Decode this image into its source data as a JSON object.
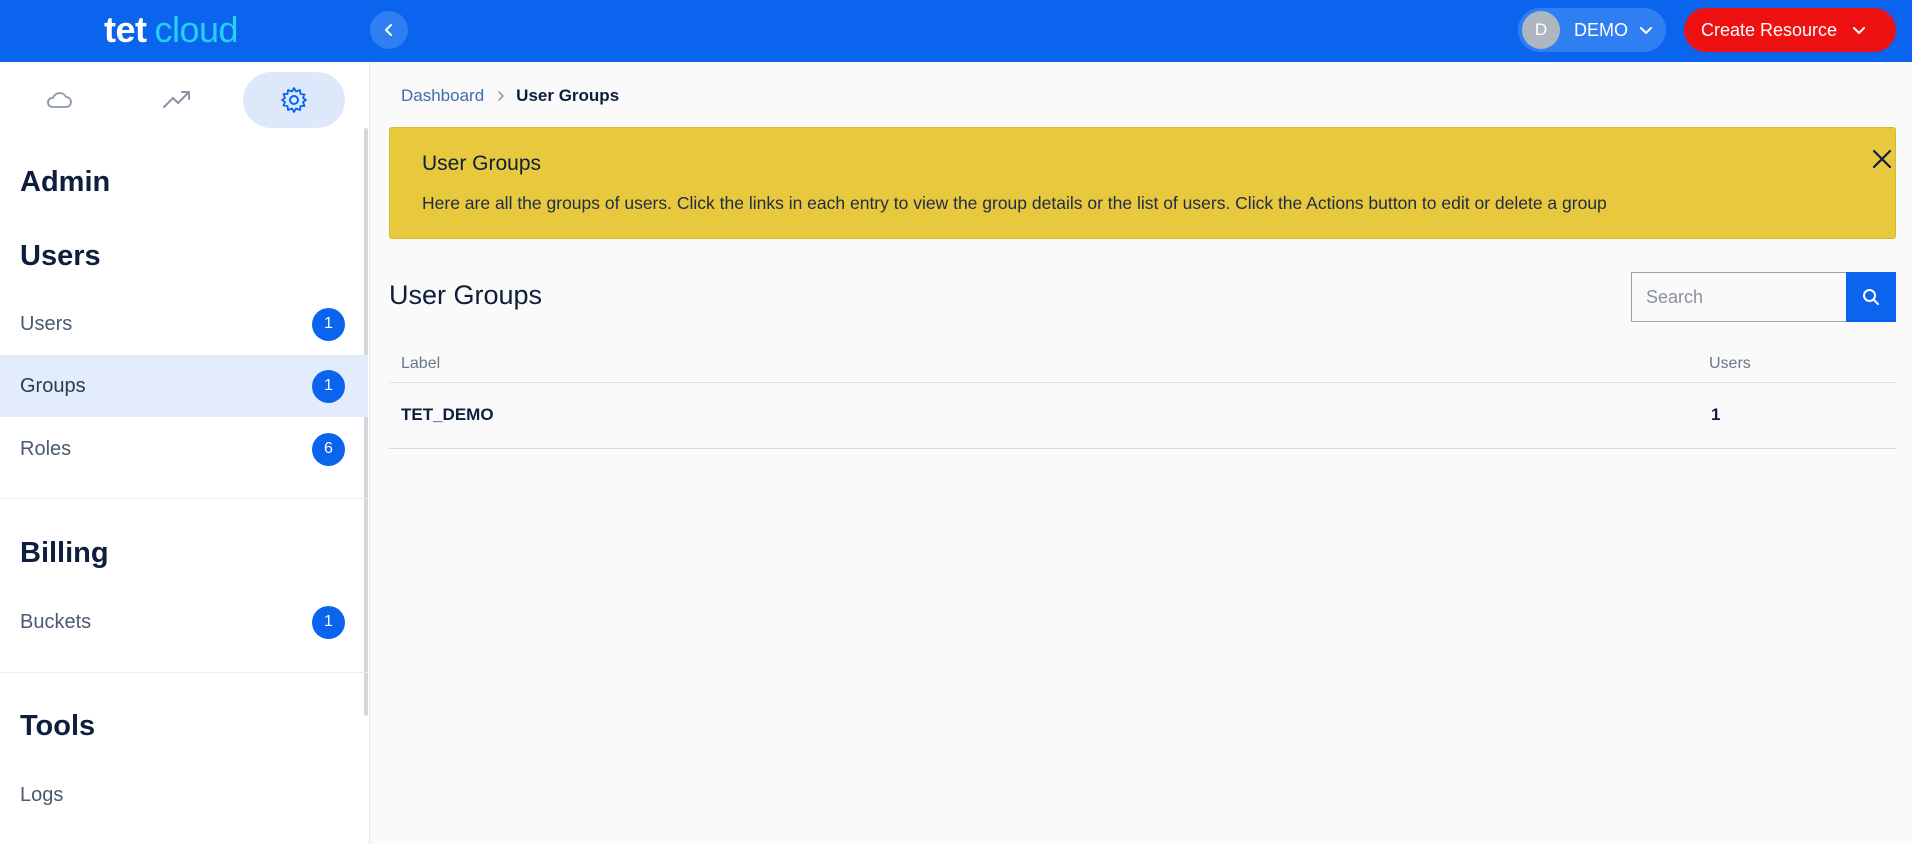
{
  "brand": {
    "logo_tet": "tet",
    "logo_cloud": "cloud"
  },
  "header": {
    "account_initial": "D",
    "account_name": "DEMO",
    "create_label": "Create Resource"
  },
  "sidebar": {
    "tabs": [
      {
        "icon": "cloud-icon",
        "active": false
      },
      {
        "icon": "trending-up-icon",
        "active": false
      },
      {
        "icon": "gear-icon",
        "active": true
      }
    ],
    "admin_heading": "Admin",
    "users_heading": "Users",
    "users_items": [
      {
        "label": "Users",
        "count": "1"
      },
      {
        "label": "Groups",
        "count": "1",
        "active": true
      },
      {
        "label": "Roles",
        "count": "6"
      }
    ],
    "billing_heading": "Billing",
    "billing_items": [
      {
        "label": "Buckets",
        "count": "1"
      }
    ],
    "tools_heading": "Tools",
    "tools_items": [
      {
        "label": "Logs"
      }
    ]
  },
  "breadcrumb": {
    "root": "Dashboard",
    "current": "User Groups"
  },
  "alert": {
    "title": "User Groups",
    "text": "Here are all the groups of users. Click the links in each entry to view the group details or the list of users. Click the Actions button to edit or delete a group"
  },
  "main": {
    "title": "User Groups",
    "search_placeholder": "Search"
  },
  "table": {
    "columns": [
      "Label",
      "Users"
    ],
    "rows": [
      {
        "label": "TET_DEMO",
        "users": "1"
      }
    ]
  },
  "colors": {
    "primary": "#0a64ee",
    "danger": "#ee1111",
    "alert": "#e8c93e",
    "logo_accent": "#25d0f5"
  }
}
